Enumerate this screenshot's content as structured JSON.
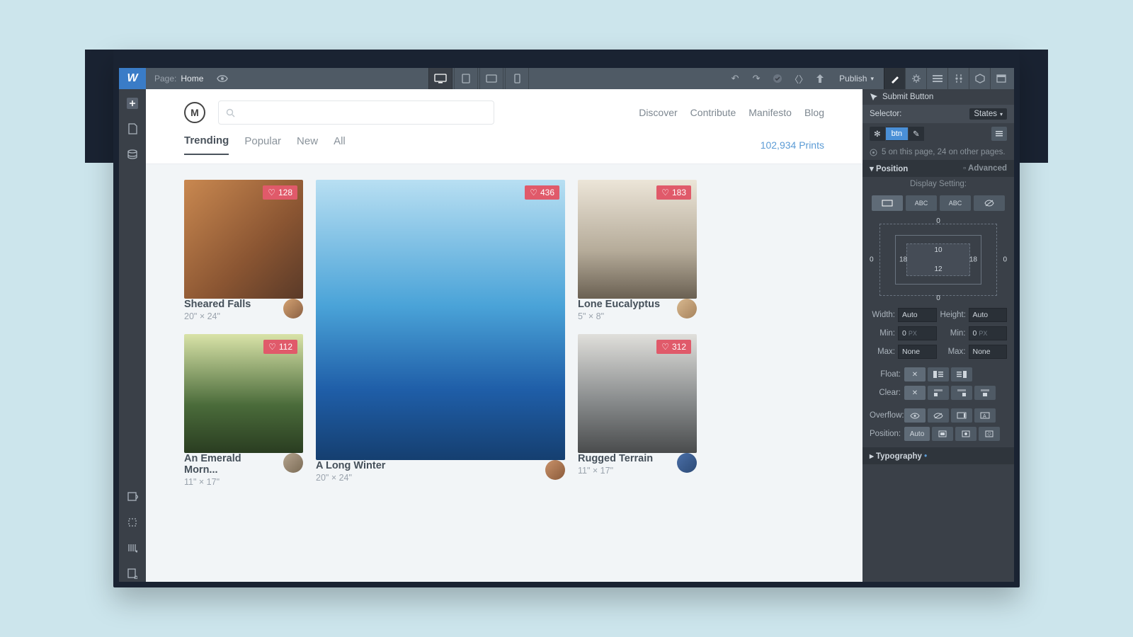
{
  "topbar": {
    "page_label": "Page:",
    "page_name": "Home",
    "publish_label": "Publish"
  },
  "site": {
    "logo_letter": "M",
    "nav": [
      "Discover",
      "Contribute",
      "Manifesto",
      "Blog"
    ],
    "tabs": [
      "Trending",
      "Popular",
      "New",
      "All"
    ],
    "count": "102,934 Prints"
  },
  "cards": {
    "c1": {
      "title": "Sheared Falls",
      "dims": "20\" × 24\"",
      "likes": "128"
    },
    "c2": {
      "title": "An Emerald Morn...",
      "dims": "11\" × 17\"",
      "likes": "112"
    },
    "c3": {
      "title": "A Long Winter",
      "dims": "20\" × 24\"",
      "likes": "436"
    },
    "c4": {
      "title": "Lone Eucalyptus",
      "dims": "5\" × 8\"",
      "likes": "183"
    },
    "c5": {
      "title": "Rugged Terrain",
      "dims": "11\" × 17\"",
      "likes": "312"
    }
  },
  "panel": {
    "element_name": "Submit Button",
    "selector_label": "Selector:",
    "selector_class": "btn",
    "states_label": "States",
    "usage_text": "5 on this page, 24 on other pages.",
    "section_position": "Position",
    "advanced_label": "Advanced",
    "display_label": "Display Setting:",
    "box": {
      "margin_top": "0",
      "margin_bottom": "0",
      "margin_left": "0",
      "margin_right": "0",
      "pad_top": "10",
      "pad_bottom": "12",
      "pad_left": "18",
      "pad_right": "18"
    },
    "width_label": "Width:",
    "height_label": "Height:",
    "min_label": "Min:",
    "max_label": "Max:",
    "auto": "Auto",
    "none": "None",
    "zero": "0",
    "px": "PX",
    "float_label": "Float:",
    "clear_label": "Clear:",
    "overflow_label": "Overflow:",
    "position_label": "Position:",
    "section_typography": "Typography"
  }
}
